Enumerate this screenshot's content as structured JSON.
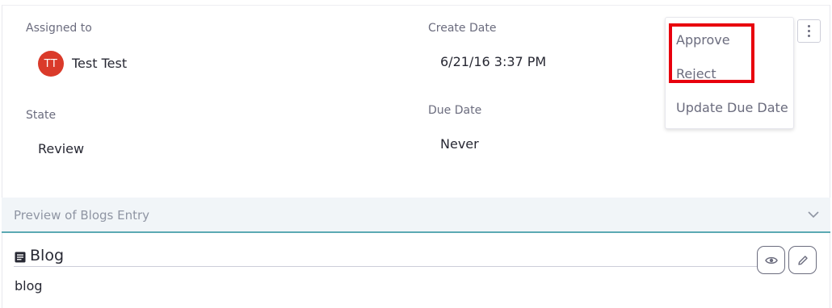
{
  "fields": {
    "assigned_to_label": "Assigned to",
    "assignee_initials": "TT",
    "assignee_name": "Test Test",
    "create_date_label": "Create Date",
    "create_date_value": "6/21/16 3:37 PM",
    "state_label": "State",
    "state_value": "Review",
    "due_date_label": "Due Date",
    "due_date_value": "Never"
  },
  "actions_menu": {
    "icon": "kebab-vertical-icon",
    "items": [
      {
        "label": "Approve"
      },
      {
        "label": "Reject"
      },
      {
        "label": "Update Due Date"
      }
    ],
    "highlight_color": "#e8000d"
  },
  "preview": {
    "header_title": "Preview of Blogs Entry",
    "collapse_icon": "chevron-down-icon",
    "entry_icon": "document-icon",
    "entry_title": "Blog",
    "entry_body": "blog",
    "view_icon": "eye-icon",
    "edit_icon": "pencil-icon"
  },
  "colors": {
    "avatar": "#da3a2a",
    "accent_rule": "#5ba9b3",
    "muted_text": "#6b6c7e"
  }
}
